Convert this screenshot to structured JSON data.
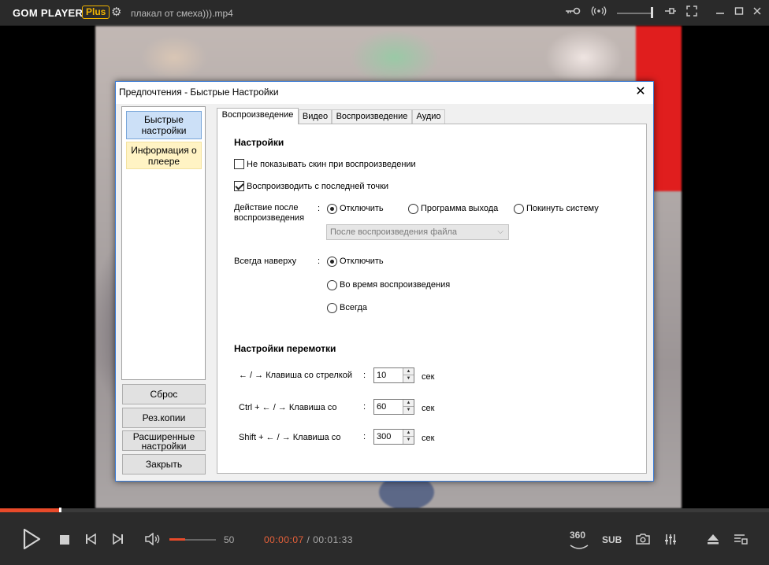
{
  "app": {
    "logo": "GOM PLAYER",
    "plus_badge": "Plus",
    "filename": "плакал от смеха))).mp4"
  },
  "dialog": {
    "title": "Предпочтения - Быстрые Настройки",
    "nav": {
      "fast": "Быстрые настройки",
      "info": "Информация о плеере"
    },
    "buttons": {
      "reset": "Сброс",
      "backup": "Рез.копии",
      "advanced": "Расширенные настройки",
      "close": "Закрыть"
    },
    "tabs": [
      "Воспроизведение",
      "Видео",
      "Воспроизведение",
      "Аудио"
    ],
    "settings_heading": "Настройки",
    "checkbox_no_skin": "Не показывать скин при воспроизведении",
    "checkbox_resume": "Воспроизводить с последней точки",
    "after_play_label": "Действие после воспроизведения",
    "colon": ":",
    "after_play_options": [
      "Отключить",
      "Программа выхода",
      "Покинуть систему"
    ],
    "after_play_combo": "После воспроизведения файла",
    "always_on_top_label": "Всегда наверху",
    "always_on_top_options": [
      "Отключить",
      "Во время воспроизведения",
      "Всегда"
    ],
    "seek_heading": "Настройки перемотки",
    "seek_rows": [
      {
        "label": "← / → Клавиша со стрелкой",
        "value": "10",
        "unit": "сек"
      },
      {
        "label": "Ctrl + ← / → Клавиша со",
        "value": "60",
        "unit": "сек"
      },
      {
        "label": "Shift + ← / → Клавиша со",
        "value": "300",
        "unit": "сек"
      }
    ]
  },
  "player": {
    "volume": "50",
    "volume_level": 0.5,
    "current_time": "00:00:07",
    "separator": " / ",
    "total_time": "00:01:33",
    "seek_progress": 0.077,
    "badge_360": "360",
    "badge_sub": "SUB"
  },
  "colors": {
    "accent": "#e84a2a",
    "plus": "#f3b400"
  }
}
